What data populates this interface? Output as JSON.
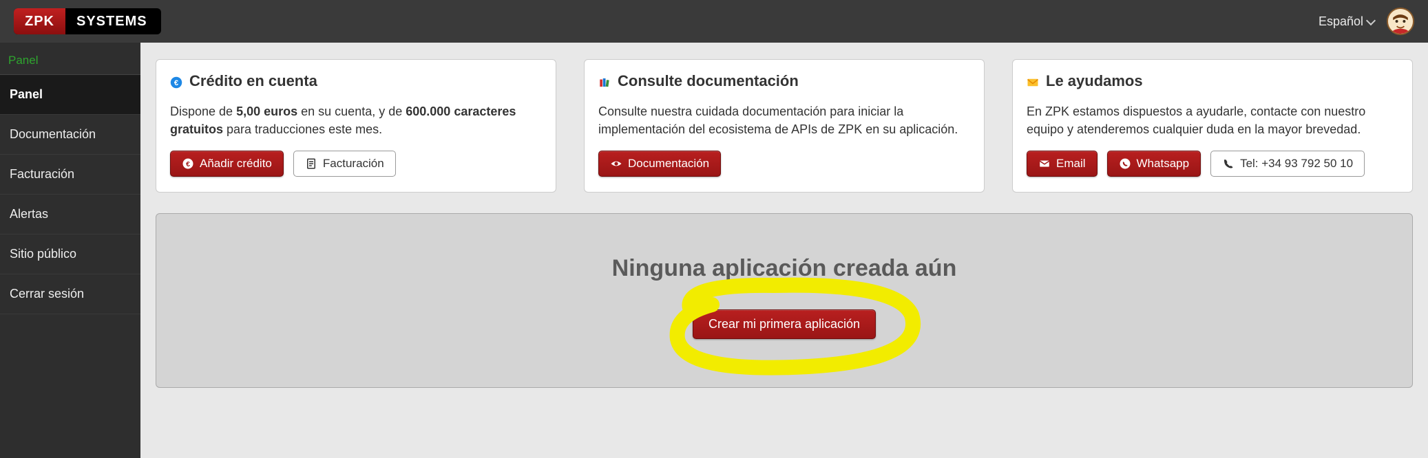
{
  "header": {
    "logo_zpk": "ZPK",
    "logo_systems": "SYSTEMS",
    "language": "Español"
  },
  "sidebar": {
    "section_label": "Panel",
    "items": [
      {
        "label": "Panel",
        "active": true
      },
      {
        "label": "Documentación",
        "active": false
      },
      {
        "label": "Facturación",
        "active": false
      },
      {
        "label": "Alertas",
        "active": false
      },
      {
        "label": "Sitio público",
        "active": false
      },
      {
        "label": "Cerrar sesión",
        "active": false
      }
    ]
  },
  "cards": {
    "credit": {
      "title": "Crédito en cuenta",
      "text_before": "Dispone de ",
      "amount": "5,00 euros",
      "text_mid": " en su cuenta, y de ",
      "chars": "600.000 caracteres gratuitos",
      "text_after": " para traducciones este mes.",
      "btn_add": "Añadir crédito",
      "btn_bill": "Facturación"
    },
    "docs": {
      "title": "Consulte documentación",
      "text": "Consulte nuestra cuidada documentación para iniciar la implementación del ecosistema de APIs de ZPK en su aplicación.",
      "btn": "Documentación"
    },
    "help": {
      "title": "Le ayudamos",
      "text": "En ZPK estamos dispuestos a ayudarle, contacte con nuestro equipo y atenderemos cualquier duda en la mayor brevedad.",
      "btn_email": "Email",
      "btn_whatsapp": "Whatsapp",
      "btn_tel": "Tel: +34 93 792 50 10"
    }
  },
  "empty": {
    "title": "Ninguna aplicación creada aún",
    "create_btn": "Crear mi primera aplicación"
  }
}
